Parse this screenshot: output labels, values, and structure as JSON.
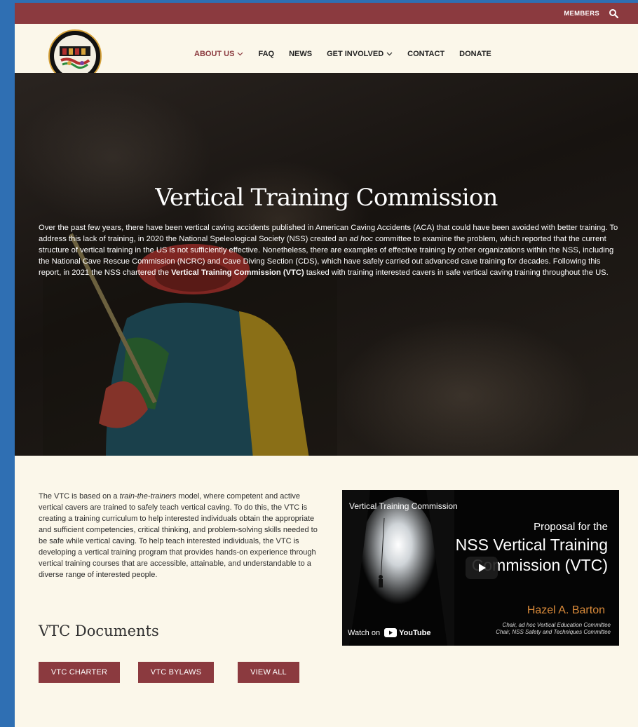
{
  "topbar": {
    "members_label": "MEMBERS"
  },
  "logo": {
    "alt": "NSS Vertical Training Commission logo"
  },
  "nav": {
    "items": [
      {
        "label": "ABOUT US",
        "dropdown": true,
        "active": true
      },
      {
        "label": "FAQ",
        "dropdown": false,
        "active": false
      },
      {
        "label": "NEWS",
        "dropdown": false,
        "active": false
      },
      {
        "label": "GET INVOLVED",
        "dropdown": true,
        "active": false
      },
      {
        "label": "CONTACT",
        "dropdown": false,
        "active": false
      },
      {
        "label": "DONATE",
        "dropdown": false,
        "active": false
      }
    ]
  },
  "hero": {
    "title": "Vertical Training Commission",
    "text_part1": "Over the past few years, there have been vertical caving accidents published in American Caving Accidents (ACA) that could have been avoided with better training. To address this lack of training, in 2020 the National Speleological Society (NSS) created an ",
    "text_italic": "ad hoc",
    "text_part2": " committee to examine the problem, which reported that the current structure of vertical training in the US is not sufficiently effective. Nonetheless, there are examples of effective training by other organizations within the NSS, including the National Cave Rescue Commission (NCRC) and Cave Diving Section (CDS), which have safely carried out advanced cave training for decades. Following this report, in 2021 the NSS chartered the ",
    "text_bold": "Vertical Training Commission (VTC)",
    "text_part3": " tasked with training interested cavers in safe vertical caving training throughout the US."
  },
  "intro": {
    "part1": "The VTC is based on a ",
    "italic": "train-the-trainers",
    "part2": " model, where competent and active vertical cavers are trained to safely teach vertical caving. To do this, the VTC is creating a training curriculum to help interested individuals obtain the appropriate and sufficient competencies, critical thinking, and problem-solving skills needed to be safe while vertical caving. To help teach interested individuals, the VTC is developing a vertical training program that provides hands-on experience through vertical training courses that are accessible, attainable, and understandable to a diverse range of interested people."
  },
  "documents": {
    "title": "VTC Documents",
    "buttons": [
      "VTC CHARTER",
      "VTC BYLAWS",
      "VIEW ALL"
    ]
  },
  "video": {
    "channel_label": "Vertical Training Commission",
    "proposal": "Proposal for the",
    "title": "NSS Vertical Training Commission (VTC)",
    "author": "Hazel A. Barton",
    "chair_line1": "Chair, ad hoc Vertical Education Committee",
    "chair_line2": "Chair, NSS Safety and Techniques Committee",
    "watch_on": "Watch on",
    "youtube": "YouTube"
  },
  "colors": {
    "brand": "#8b3a3f",
    "background": "#fbf7ea",
    "frame": "#2f6fb3"
  }
}
